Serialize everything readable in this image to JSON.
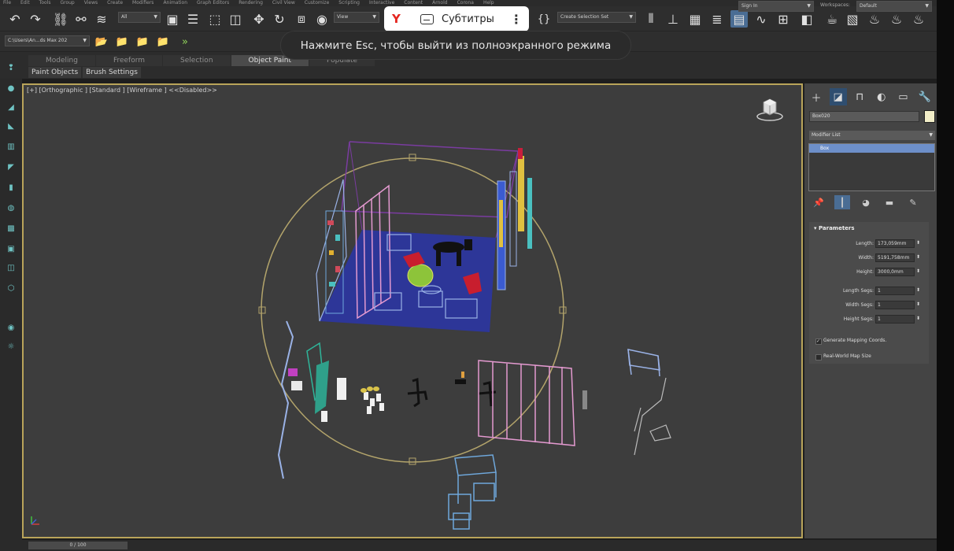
{
  "menubar": [
    "File",
    "Edit",
    "Tools",
    "Group",
    "Views",
    "Create",
    "Modifiers",
    "Animation",
    "Graph Editors",
    "Rendering",
    "Civil View",
    "Customize",
    "Scripting",
    "Interactive",
    "Content",
    "Arnold",
    "Corona",
    "Help"
  ],
  "toolbar": {
    "selection_filter": "All",
    "ref_coord": "View",
    "named_selection": "Create Selection Set",
    "signin": "Sign In",
    "workspaces_label": "Workspaces:",
    "workspace_value": "Default",
    "project_path": "C:\\Users\\An...ds Max 202"
  },
  "ribbon": {
    "tabs": [
      "Modeling",
      "Freeform",
      "Selection",
      "Object Paint",
      "Populate"
    ],
    "active_tab": 3,
    "subtabs": [
      "Paint Objects",
      "Brush Settings"
    ]
  },
  "viewport": {
    "label": "[+] [Orthographic ] [Standard ] [Wireframe ]  <<Disabled>>",
    "border_color": "#b9a45a"
  },
  "cmdpanel": {
    "object_name": "Box020",
    "object_color": "#f2eec8",
    "modifier_list": "Modifier List",
    "stack_item": "Box",
    "params_title": "Parameters",
    "params": [
      {
        "label": "Length:",
        "value": "173,059mm"
      },
      {
        "label": "Width:",
        "value": "5191,758mm"
      },
      {
        "label": "Height:",
        "value": "3000,0mm"
      },
      {
        "label": "Length Segs:",
        "value": "1"
      },
      {
        "label": "Width Segs:",
        "value": "1"
      },
      {
        "label": "Height Segs:",
        "value": "1"
      }
    ],
    "gen_mapping": "Generate Mapping Coords.",
    "real_world": "Real-World Map Size"
  },
  "statusbar": {
    "time": "0 / 100"
  },
  "overlay": {
    "subtitles_label": "Субтитры",
    "toast": "Нажмите Esc, чтобы выйти из полноэкранного режима"
  },
  "icons": [
    "undo-icon",
    "redo-icon",
    "link-icon",
    "unlink-icon",
    "bind-spacewarp-icon",
    "select-icon",
    "move-icon",
    "rotate-icon",
    "scale-icon",
    "viewcube-icon",
    "yandex-logo",
    "subtitles-icon",
    "more-icon"
  ]
}
